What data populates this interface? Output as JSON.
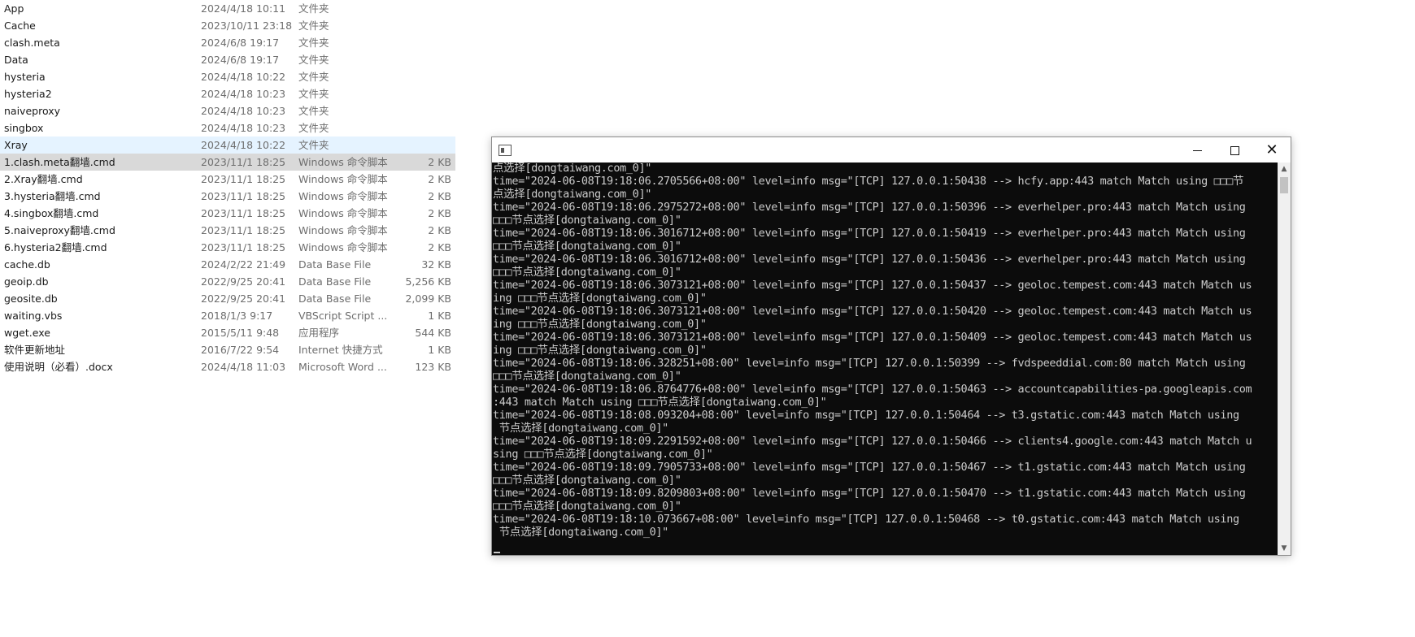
{
  "explorer": {
    "files": [
      {
        "name": "App",
        "date": "2024/4/18 10:11",
        "type": "文件夹",
        "size": ""
      },
      {
        "name": "Cache",
        "date": "2023/10/11 23:18",
        "type": "文件夹",
        "size": ""
      },
      {
        "name": "clash.meta",
        "date": "2024/6/8 19:17",
        "type": "文件夹",
        "size": ""
      },
      {
        "name": "Data",
        "date": "2024/6/8 19:17",
        "type": "文件夹",
        "size": ""
      },
      {
        "name": "hysteria",
        "date": "2024/4/18 10:22",
        "type": "文件夹",
        "size": ""
      },
      {
        "name": "hysteria2",
        "date": "2024/4/18 10:23",
        "type": "文件夹",
        "size": ""
      },
      {
        "name": "naiveproxy",
        "date": "2024/4/18 10:23",
        "type": "文件夹",
        "size": ""
      },
      {
        "name": "singbox",
        "date": "2024/4/18 10:23",
        "type": "文件夹",
        "size": ""
      },
      {
        "name": "Xray",
        "date": "2024/4/18 10:22",
        "type": "文件夹",
        "size": ""
      },
      {
        "name": "1.clash.meta翻墙.cmd",
        "date": "2023/11/1 18:25",
        "type": "Windows 命令脚本",
        "size": "2 KB"
      },
      {
        "name": "2.Xray翻墙.cmd",
        "date": "2023/11/1 18:25",
        "type": "Windows 命令脚本",
        "size": "2 KB"
      },
      {
        "name": "3.hysteria翻墙.cmd",
        "date": "2023/11/1 18:25",
        "type": "Windows 命令脚本",
        "size": "2 KB"
      },
      {
        "name": "4.singbox翻墙.cmd",
        "date": "2023/11/1 18:25",
        "type": "Windows 命令脚本",
        "size": "2 KB"
      },
      {
        "name": "5.naiveproxy翻墙.cmd",
        "date": "2023/11/1 18:25",
        "type": "Windows 命令脚本",
        "size": "2 KB"
      },
      {
        "name": "6.hysteria2翻墙.cmd",
        "date": "2023/11/1 18:25",
        "type": "Windows 命令脚本",
        "size": "2 KB"
      },
      {
        "name": "cache.db",
        "date": "2024/2/22 21:49",
        "type": "Data Base File",
        "size": "32 KB"
      },
      {
        "name": "geoip.db",
        "date": "2022/9/25 20:41",
        "type": "Data Base File",
        "size": "5,256 KB"
      },
      {
        "name": "geosite.db",
        "date": "2022/9/25 20:41",
        "type": "Data Base File",
        "size": "2,099 KB"
      },
      {
        "name": "waiting.vbs",
        "date": "2018/1/3 9:17",
        "type": "VBScript Script ...",
        "size": "1 KB"
      },
      {
        "name": "wget.exe",
        "date": "2015/5/11 9:48",
        "type": "应用程序",
        "size": "544 KB"
      },
      {
        "name": "软件更新地址",
        "date": "2016/7/22 9:54",
        "type": "Internet 快捷方式",
        "size": "1 KB"
      },
      {
        "name": "使用说明（必看）.docx",
        "date": "2024/4/18 11:03",
        "type": "Microsoft Word ...",
        "size": "123 KB"
      }
    ]
  },
  "console": {
    "lines": [
      "点选择[dongtaiwang.com_0]\"",
      "time=\"2024-06-08T19:18:06.2705566+08:00\" level=info msg=\"[TCP] 127.0.0.1:50438 --> hcfy.app:443 match Match using □□□节",
      "点选择[dongtaiwang.com_0]\"",
      "time=\"2024-06-08T19:18:06.2975272+08:00\" level=info msg=\"[TCP] 127.0.0.1:50396 --> everhelper.pro:443 match Match using",
      "□□□节点选择[dongtaiwang.com_0]\"",
      "time=\"2024-06-08T19:18:06.3016712+08:00\" level=info msg=\"[TCP] 127.0.0.1:50419 --> everhelper.pro:443 match Match using",
      "□□□节点选择[dongtaiwang.com_0]\"",
      "time=\"2024-06-08T19:18:06.3016712+08:00\" level=info msg=\"[TCP] 127.0.0.1:50436 --> everhelper.pro:443 match Match using",
      "□□□节点选择[dongtaiwang.com_0]\"",
      "time=\"2024-06-08T19:18:06.3073121+08:00\" level=info msg=\"[TCP] 127.0.0.1:50437 --> geoloc.tempest.com:443 match Match us",
      "ing □□□节点选择[dongtaiwang.com_0]\"",
      "time=\"2024-06-08T19:18:06.3073121+08:00\" level=info msg=\"[TCP] 127.0.0.1:50420 --> geoloc.tempest.com:443 match Match us",
      "ing □□□节点选择[dongtaiwang.com_0]\"",
      "time=\"2024-06-08T19:18:06.3073121+08:00\" level=info msg=\"[TCP] 127.0.0.1:50409 --> geoloc.tempest.com:443 match Match us",
      "ing □□□节点选择[dongtaiwang.com_0]\"",
      "time=\"2024-06-08T19:18:06.328251+08:00\" level=info msg=\"[TCP] 127.0.0.1:50399 --> fvdspeeddial.com:80 match Match using",
      "□□□节点选择[dongtaiwang.com_0]\"",
      "time=\"2024-06-08T19:18:06.8764776+08:00\" level=info msg=\"[TCP] 127.0.0.1:50463 --> accountcapabilities-pa.googleapis.com",
      ":443 match Match using □□□节点选择[dongtaiwang.com_0]\"",
      "time=\"2024-06-08T19:18:08.093204+08:00\" level=info msg=\"[TCP] 127.0.0.1:50464 --> t3.gstatic.com:443 match Match using",
      " 节点选择[dongtaiwang.com_0]\"",
      "time=\"2024-06-08T19:18:09.2291592+08:00\" level=info msg=\"[TCP] 127.0.0.1:50466 --> clients4.google.com:443 match Match u",
      "sing □□□节点选择[dongtaiwang.com_0]\"",
      "time=\"2024-06-08T19:18:09.7905733+08:00\" level=info msg=\"[TCP] 127.0.0.1:50467 --> t1.gstatic.com:443 match Match using",
      "□□□节点选择[dongtaiwang.com_0]\"",
      "time=\"2024-06-08T19:18:09.8209803+08:00\" level=info msg=\"[TCP] 127.0.0.1:50470 --> t1.gstatic.com:443 match Match using",
      "□□□节点选择[dongtaiwang.com_0]\"",
      "time=\"2024-06-08T19:18:10.073667+08:00\" level=info msg=\"[TCP] 127.0.0.1:50468 --> t0.gstatic.com:443 match Match using",
      " 节点选择[dongtaiwang.com_0]\""
    ],
    "icons": {
      "app": "console-app-icon",
      "minimize": "minimize-icon",
      "maximize": "maximize-icon",
      "close": "close-icon",
      "scroll_up": "scroll-up-arrow-icon",
      "scroll_down": "scroll-down-arrow-icon"
    },
    "close_glyph": "✕",
    "up_glyph": "▲",
    "down_glyph": "▼"
  }
}
